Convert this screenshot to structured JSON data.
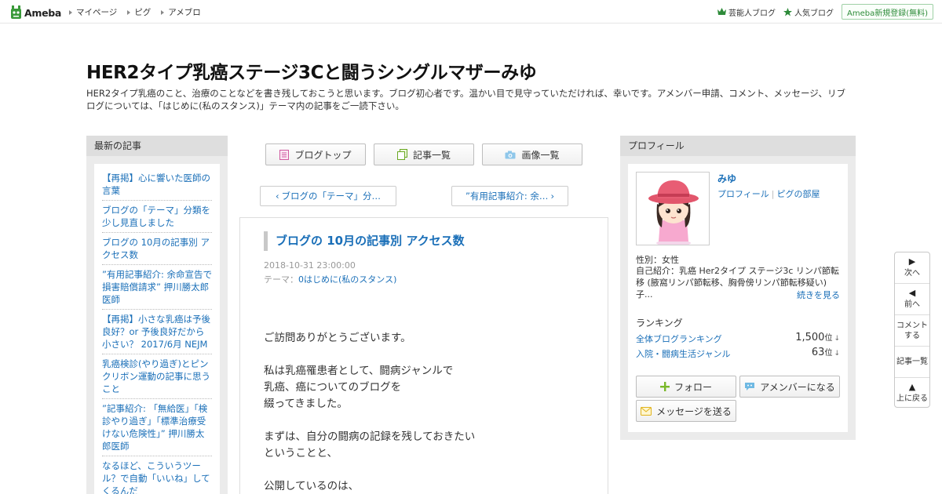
{
  "topbar": {
    "logo_text": "Ameba",
    "nav": [
      "マイページ",
      "ピグ",
      "アメブロ"
    ],
    "right_links": [
      {
        "label": "芸能人ブログ",
        "icon": "crown-icon"
      },
      {
        "label": "人気ブログ",
        "icon": "star-icon"
      }
    ],
    "register_label": "Ameba新規登録(無料)"
  },
  "blog": {
    "title": "HER2タイプ乳癌ステージ3Cと闘うシングルマザーみゆ",
    "description": "HER2タイプ乳癌のこと、治療のことなどを書き残しておこうと思います。ブログ初心者です。温かい目で見守っていただければ、幸いです。アメンバー申請、コメント、メッセージ、リブログについては、「はじめに(私のスタンス)」テーマ内の記事をご一読下さい。"
  },
  "left_sidebar": {
    "heading": "最新の記事",
    "items": [
      "【再掲】心に響いた医師の言葉",
      "ブログの「テーマ」分類を少し見直しました",
      "ブログの 10月の記事別 アクセス数",
      "”有用記事紹介: 余命宣告で損害賠償請求” 押川勝太郎医師",
      "【再掲】小さな乳癌は予後良好？or 予後良好だから小さい？ 2017/6月 NEJM",
      "乳癌検診(やり過ぎ)とピンクリボン運動の記事に思うこと",
      "”記事紹介: 「無給医」「検診やり過ぎ」「標準治療受けない危険性」” 押川勝太郎医師",
      "なるほど、こういうツール？で自動「いいね」してくるんだ"
    ]
  },
  "center": {
    "tabs": [
      {
        "label": "ブログトップ",
        "icon": "document-icon"
      },
      {
        "label": "記事一覧",
        "icon": "copy-icon"
      },
      {
        "label": "画像一覧",
        "icon": "camera-icon"
      }
    ],
    "prev_label": "ブログの「テーマ」分…",
    "next_label": "”有用記事紹介: 余…",
    "article": {
      "title": "ブログの 10月の記事別 アクセス数",
      "date": "2018-10-31 23:00:00",
      "theme_prefix": "テーマ：",
      "theme": "0はじめに(私のスタンス)",
      "body_lines": [
        "ご訪問ありがとうございます。",
        "",
        "私は乳癌罹患者として、闘病ジャンルで",
        "乳癌、癌についてのブログを",
        "綴ってきました。",
        "",
        "まずは、自分の闘病の記録を残しておきたい",
        "ということと、",
        "",
        "公開しているのは、"
      ]
    }
  },
  "right_sidebar": {
    "heading": "プロフィール",
    "name": "みゆ",
    "link_profile": "プロフィール",
    "link_room": "ピグの部屋",
    "gender": "性別：女性",
    "intro": "自己紹介：乳癌 Her2タイプ ステージ3c リンパ節転移 (腋窩リンパ節転移、胸骨傍リンパ節転移疑い) 子...",
    "more_label": "続きを見る",
    "ranking_heading": "ランキング",
    "rankings": [
      {
        "name": "全体ブログランキング",
        "value": "1,500",
        "unit": "位"
      },
      {
        "name": "入院・闘病生活ジャンル",
        "value": "63",
        "unit": "位"
      }
    ],
    "buttons": {
      "follow": "フォロー",
      "amember": "アメンバーになる",
      "message": "メッセージを送る"
    }
  },
  "sidenav": {
    "next": "次へ",
    "prev": "前へ",
    "comment_line1": "コメント",
    "comment_line2": "する",
    "list": "記事一覧",
    "top": "上に戻る"
  },
  "colors": {
    "link": "#1a6fb8",
    "brand_green": "#2e8b3a"
  }
}
